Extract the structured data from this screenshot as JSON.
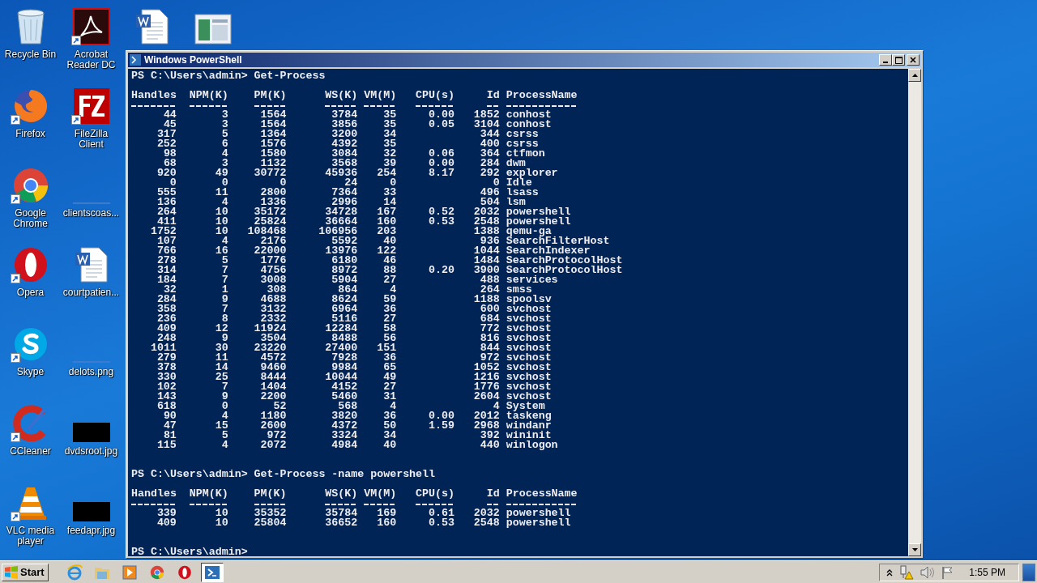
{
  "desktop": {
    "columns": [
      [
        {
          "label": "Recycle Bin",
          "kind": "recycle",
          "shortcut": false
        },
        {
          "label": "Firefox",
          "kind": "firefox",
          "shortcut": true
        },
        {
          "label": "Google Chrome",
          "kind": "chrome",
          "shortcut": true
        },
        {
          "label": "Opera",
          "kind": "opera",
          "shortcut": true
        },
        {
          "label": "Skype",
          "kind": "skype",
          "shortcut": true
        },
        {
          "label": "CCleaner",
          "kind": "ccleaner",
          "shortcut": true
        },
        {
          "label": "VLC media player",
          "kind": "vlc",
          "shortcut": true
        }
      ],
      [
        {
          "label": "Acrobat Reader DC",
          "kind": "acrobat",
          "shortcut": true
        },
        {
          "label": "FileZilla Client",
          "kind": "filezilla",
          "shortcut": true
        },
        {
          "label": "clientscoas...",
          "kind": "blank",
          "shortcut": false
        },
        {
          "label": "courtpatien...",
          "kind": "word",
          "shortcut": false
        },
        {
          "label": "delots.png",
          "kind": "blank",
          "shortcut": false
        },
        {
          "label": "dvdsroot.jpg",
          "kind": "dark",
          "shortcut": false
        },
        {
          "label": "feedapr.jpg",
          "kind": "dark",
          "shortcut": false
        }
      ],
      [
        {
          "kind": "word",
          "shortcut": false
        }
      ],
      [
        {
          "kind": "window",
          "shortcut": false
        }
      ]
    ]
  },
  "window": {
    "title": "Windows PowerShell",
    "console": {
      "blocks": [
        {
          "command_line": "PS C:\\Users\\admin> Get-Process",
          "columns": [
            "Handles",
            "NPM(K)",
            "PM(K)",
            "WS(K)",
            "VM(M)",
            "CPU(s)",
            "Id",
            "ProcessName"
          ],
          "rows": [
            [
              "44",
              "3",
              "1564",
              "3784",
              "35",
              "0.00",
              "1852",
              "conhost"
            ],
            [
              "45",
              "3",
              "1564",
              "3856",
              "35",
              "0.05",
              "3104",
              "conhost"
            ],
            [
              "317",
              "5",
              "1364",
              "3200",
              "34",
              null,
              "344",
              "csrss"
            ],
            [
              "252",
              "6",
              "1576",
              "4392",
              "35",
              null,
              "400",
              "csrss"
            ],
            [
              "98",
              "4",
              "1580",
              "3084",
              "32",
              "0.06",
              "364",
              "ctfmon"
            ],
            [
              "68",
              "3",
              "1132",
              "3568",
              "39",
              "0.00",
              "284",
              "dwm"
            ],
            [
              "920",
              "49",
              "30772",
              "45936",
              "254",
              "8.17",
              "292",
              "explorer"
            ],
            [
              "0",
              "0",
              "0",
              "24",
              "0",
              null,
              "0",
              "Idle"
            ],
            [
              "555",
              "11",
              "2800",
              "7364",
              "33",
              null,
              "496",
              "lsass"
            ],
            [
              "136",
              "4",
              "1336",
              "2996",
              "14",
              null,
              "504",
              "lsm"
            ],
            [
              "264",
              "10",
              "35172",
              "34728",
              "167",
              "0.52",
              "2032",
              "powershell"
            ],
            [
              "411",
              "10",
              "25824",
              "36664",
              "160",
              "0.53",
              "2548",
              "powershell"
            ],
            [
              "1752",
              "10",
              "108468",
              "106956",
              "203",
              null,
              "1388",
              "qemu-ga"
            ],
            [
              "107",
              "4",
              "2176",
              "5592",
              "40",
              null,
              "936",
              "SearchFilterHost"
            ],
            [
              "766",
              "16",
              "22000",
              "13976",
              "122",
              null,
              "1044",
              "SearchIndexer"
            ],
            [
              "278",
              "5",
              "1776",
              "6180",
              "46",
              null,
              "1484",
              "SearchProtocolHost"
            ],
            [
              "314",
              "7",
              "4756",
              "8972",
              "88",
              "0.20",
              "3900",
              "SearchProtocolHost"
            ],
            [
              "184",
              "7",
              "3008",
              "5904",
              "27",
              null,
              "488",
              "services"
            ],
            [
              "32",
              "1",
              "308",
              "864",
              "4",
              null,
              "264",
              "smss"
            ],
            [
              "284",
              "9",
              "4688",
              "8624",
              "59",
              null,
              "1188",
              "spoolsv"
            ],
            [
              "358",
              "7",
              "3132",
              "6964",
              "36",
              null,
              "600",
              "svchost"
            ],
            [
              "236",
              "8",
              "2332",
              "5116",
              "27",
              null,
              "684",
              "svchost"
            ],
            [
              "409",
              "12",
              "11924",
              "12284",
              "58",
              null,
              "772",
              "svchost"
            ],
            [
              "248",
              "9",
              "3504",
              "8488",
              "56",
              null,
              "816",
              "svchost"
            ],
            [
              "1011",
              "30",
              "23220",
              "27400",
              "151",
              null,
              "844",
              "svchost"
            ],
            [
              "279",
              "11",
              "4572",
              "7928",
              "36",
              null,
              "972",
              "svchost"
            ],
            [
              "378",
              "14",
              "9460",
              "9984",
              "65",
              null,
              "1052",
              "svchost"
            ],
            [
              "330",
              "25",
              "8444",
              "10044",
              "49",
              null,
              "1216",
              "svchost"
            ],
            [
              "102",
              "7",
              "1404",
              "4152",
              "27",
              null,
              "1776",
              "svchost"
            ],
            [
              "143",
              "9",
              "2200",
              "5460",
              "31",
              null,
              "2604",
              "svchost"
            ],
            [
              "618",
              "0",
              "52",
              "568",
              "4",
              null,
              "4",
              "System"
            ],
            [
              "90",
              "4",
              "1180",
              "3820",
              "36",
              "0.00",
              "2012",
              "taskeng"
            ],
            [
              "47",
              "15",
              "2600",
              "4372",
              "50",
              "1.59",
              "2968",
              "windanr"
            ],
            [
              "81",
              "5",
              "972",
              "3324",
              "34",
              null,
              "392",
              "wininit"
            ],
            [
              "115",
              "4",
              "2072",
              "4984",
              "40",
              null,
              "440",
              "winlogon"
            ]
          ]
        },
        {
          "command_line": "PS C:\\Users\\admin> Get-Process -name powershell",
          "columns": [
            "Handles",
            "NPM(K)",
            "PM(K)",
            "WS(K)",
            "VM(M)",
            "CPU(s)",
            "Id",
            "ProcessName"
          ],
          "rows": [
            [
              "339",
              "10",
              "35352",
              "35784",
              "169",
              "0.61",
              "2032",
              "powershell"
            ],
            [
              "409",
              "10",
              "25804",
              "36652",
              "160",
              "0.53",
              "2548",
              "powershell"
            ]
          ]
        }
      ],
      "final_prompt": "PS C:\\Users\\admin>"
    }
  },
  "taskbar": {
    "start_label": "Start",
    "apps": [
      {
        "kind": "ie",
        "selected": false
      },
      {
        "kind": "folder",
        "selected": false
      },
      {
        "kind": "media",
        "selected": false
      },
      {
        "kind": "chrome",
        "selected": false
      },
      {
        "kind": "opera",
        "selected": false
      },
      {
        "kind": "powershell",
        "selected": true
      }
    ],
    "clock": "1:55 PM"
  }
}
